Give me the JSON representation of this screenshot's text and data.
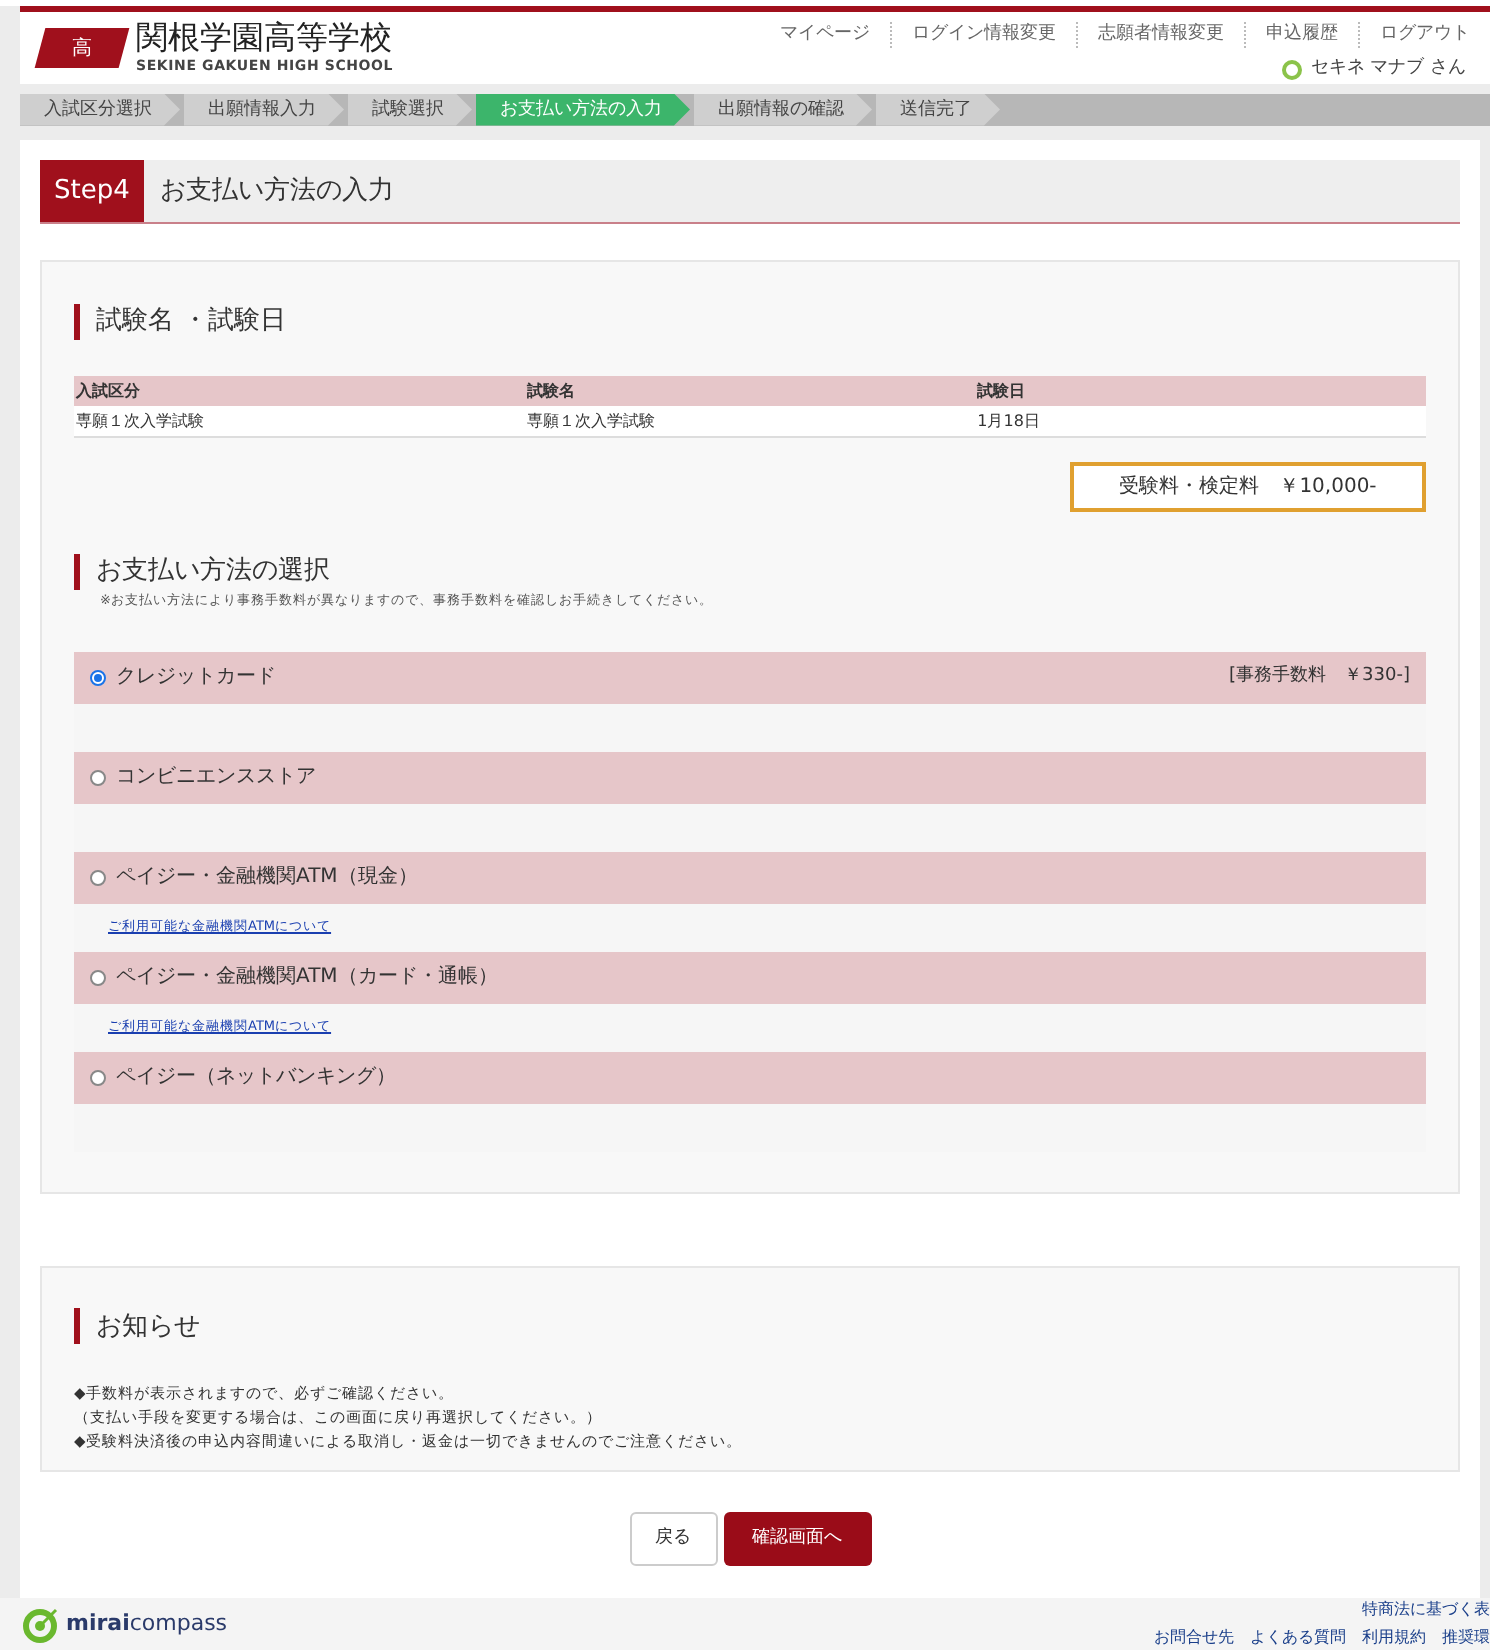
{
  "header": {
    "logo_mark": "高",
    "school_name": "関根学園高等学校",
    "school_name_en": "SEKINE GAKUEN HIGH SCHOOL",
    "nav": [
      "マイページ",
      "ログイン情報変更",
      "志願者情報変更",
      "申込履歴",
      "ログアウト"
    ],
    "user": "セキネ マナブ さん"
  },
  "steps": [
    {
      "label": "入試区分選択",
      "selected": false
    },
    {
      "label": "出願情報入力",
      "selected": false
    },
    {
      "label": "試験選択",
      "selected": false
    },
    {
      "label": "お支払い方法の入力",
      "selected": true
    },
    {
      "label": "出願情報の確認",
      "selected": false
    },
    {
      "label": "送信完了",
      "selected": false
    }
  ],
  "page_title": {
    "step": "Step4",
    "title": "お支払い方法の入力"
  },
  "exam": {
    "heading": "試験名 ・試験日",
    "table": {
      "columns": [
        "入試区分",
        "試験名",
        "試験日"
      ],
      "rows": [
        [
          "専願１次入学試験",
          "専願１次入学試験",
          "1月18日"
        ]
      ]
    },
    "fee": "受験料・検定料　￥10,000-"
  },
  "payment": {
    "heading": "お支払い方法の選択",
    "note": "※お支払い方法により事務手数料が異なりますので、事務手数料を確認しお手続きしてください。",
    "options": [
      {
        "label": "クレジットカード",
        "selected": true,
        "fee": "[事務手数料　￥330-]"
      },
      {
        "label": "コンビニエンスストア",
        "selected": false
      },
      {
        "label": "ペイジー・金融機関ATM（現金）",
        "selected": false,
        "link": "ご利用可能な金融機関ATMについて"
      },
      {
        "label": "ペイジー・金融機関ATM（カード・通帳）",
        "selected": false,
        "link": "ご利用可能な金融機関ATMについて"
      },
      {
        "label": "ペイジー（ネットバンキング）",
        "selected": false
      }
    ]
  },
  "notice": {
    "heading": "お知らせ",
    "lines": [
      "◆手数料が表示されますので、必ずご確認ください。",
      "（支払い手段を変更する場合は、この画面に戻り再選択してください。）",
      "◆受験料決済後の申込内容間違いによる取消し・返金は一切できませんのでご注意ください。"
    ]
  },
  "buttons": {
    "back": "戻る",
    "next": "確認画面へ"
  },
  "footer": {
    "brand_bold": "mirai",
    "brand": "compass",
    "links_top": [
      "特商法に基づく表"
    ],
    "links": [
      "お問合せ先",
      "よくある質問",
      "利用規約",
      "推奨環"
    ]
  }
}
